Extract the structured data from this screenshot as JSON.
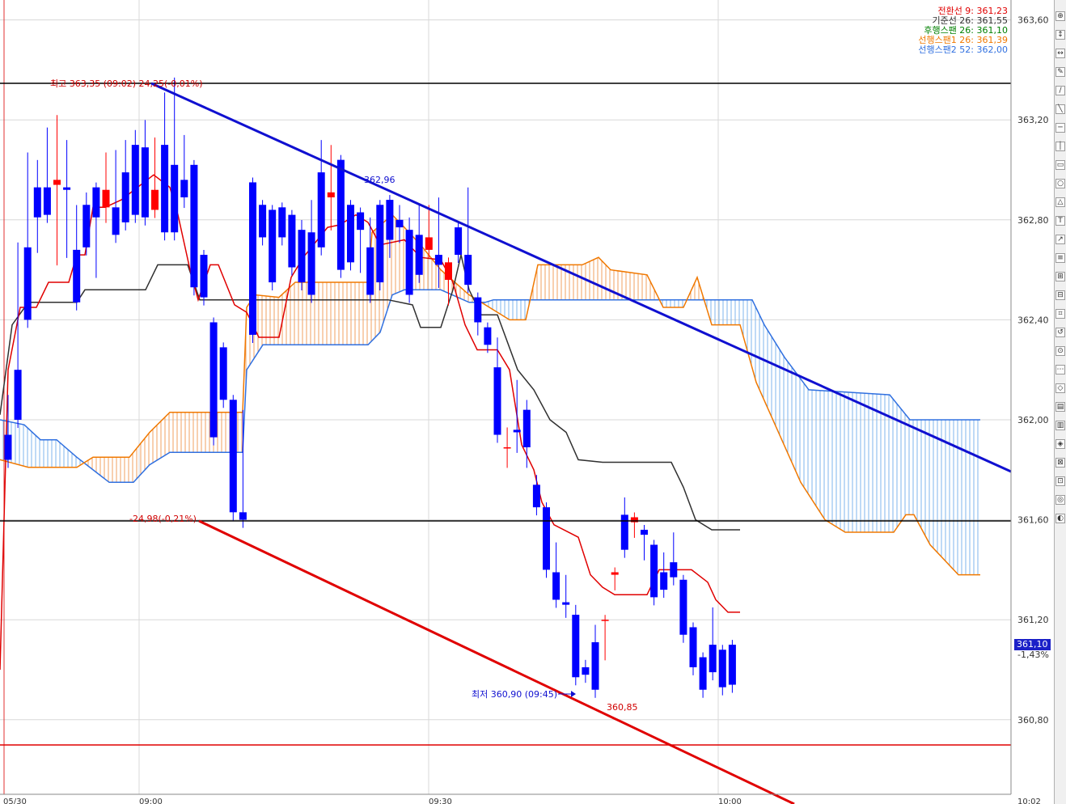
{
  "chart_data": {
    "type": "candlestick",
    "yaxis": {
      "ticks": [
        "360,80",
        "361,20",
        "361,60",
        "362,00",
        "362,40",
        "362,80",
        "363,20",
        "363,60"
      ]
    },
    "xaxis": {
      "ticks": [
        "05/30",
        "09:00",
        "09:30",
        "10:00",
        "10:02"
      ]
    },
    "legend": [
      {
        "text": "전환선 9: 361,23",
        "color": "#e00000"
      },
      {
        "text": "기준선 26: 361,55",
        "color": "#303030"
      },
      {
        "text": "후행스팬 26: 361,10",
        "color": "#008000"
      },
      {
        "text": "선행스팬1 26: 361,39",
        "color": "#f07800"
      },
      {
        "text": "선행스팬2 52: 362,00",
        "color": "#3070e0"
      }
    ],
    "annotations": {
      "high": "최고 363,35 (09:02) 24,25(-0,01%)",
      "low": "최저 360,90 (09:45)",
      "low_pct": "-24,98(-0,21%)",
      "trend_upper": "362,96",
      "trend_lower": "360,85"
    },
    "last_price": "361,10",
    "last_change": "-1,43%",
    "candles": [
      [
        361.94,
        362.08,
        361.85,
        361.84
      ],
      [
        362.2,
        362.69,
        362.19,
        362.0
      ],
      [
        362.69,
        363.05,
        362.69,
        362.4
      ],
      [
        362.93,
        363.02,
        362.7,
        362.81
      ],
      [
        362.93,
        363.15,
        362.84,
        362.82
      ],
      [
        362.94,
        363.2,
        362.65,
        362.96
      ],
      [
        362.93,
        363.1,
        362.68,
        362.92
      ],
      [
        362.68,
        362.84,
        362.68,
        362.47
      ],
      [
        362.86,
        362.89,
        362.86,
        362.69
      ],
      [
        362.93,
        362.93,
        362.6,
        362.81
      ],
      [
        362.85,
        363.05,
        362.82,
        362.92
      ],
      [
        362.85,
        363.06,
        362.92,
        362.74
      ],
      [
        362.99,
        363.1,
        362.96,
        362.79
      ],
      [
        363.1,
        363.14,
        362.91,
        362.82
      ],
      [
        363.09,
        363.18,
        362.96,
        362.81
      ],
      [
        362.84,
        363.11,
        362.84,
        362.92
      ],
      [
        363.1,
        363.29,
        362.91,
        362.75
      ],
      [
        363.02,
        363.35,
        362.91,
        362.75
      ],
      [
        362.96,
        363.12,
        362.88,
        362.89
      ],
      [
        363.02,
        363.02,
        362.66,
        362.53
      ],
      [
        362.66,
        362.66,
        362.49,
        362.49
      ],
      [
        362.39,
        362.39,
        362.35,
        361.93
      ],
      [
        362.29,
        362.2,
        362.29,
        362.08
      ],
      [
        362.08,
        362.08,
        361.91,
        361.63
      ],
      [
        361.63,
        362.02,
        362.28,
        361.6
      ],
      [
        362.95,
        362.95,
        362.47,
        362.34
      ],
      [
        362.86,
        362.86,
        362.86,
        362.73
      ],
      [
        362.84,
        362.84,
        362.6,
        362.55
      ],
      [
        362.85,
        362.82,
        362.85,
        362.73
      ],
      [
        362.82,
        362.64,
        362.88,
        362.61
      ],
      [
        362.76,
        362.78,
        362.76,
        362.55
      ],
      [
        362.75,
        362.86,
        362.66,
        362.5
      ],
      [
        362.99,
        363.1,
        362.73,
        362.69
      ],
      [
        362.89,
        363.08,
        362.79,
        362.91
      ],
      [
        363.04,
        363.04,
        362.61,
        362.6
      ],
      [
        362.86,
        362.86,
        362.86,
        362.63
      ],
      [
        362.83,
        362.83,
        362.62,
        362.76
      ],
      [
        362.69,
        362.79,
        362.58,
        362.5
      ],
      [
        362.86,
        362.83,
        362.73,
        362.55
      ],
      [
        362.88,
        362.78,
        362.68,
        362.72
      ],
      [
        362.8,
        362.84,
        362.74,
        362.77
      ],
      [
        362.76,
        362.79,
        362.53,
        362.5
      ],
      [
        362.74,
        362.84,
        362.6,
        362.58
      ],
      [
        362.68,
        362.84,
        362.7,
        362.73
      ],
      [
        362.66,
        362.87,
        362.56,
        362.62
      ],
      [
        362.56,
        362.61,
        362.49,
        362.63
      ],
      [
        362.77,
        362.72,
        362.67,
        362.66
      ],
      [
        362.66,
        362.91,
        362.57,
        362.54
      ],
      [
        362.49,
        362.48,
        362.37,
        362.39
      ],
      [
        362.37,
        362.32,
        362.36,
        362.3
      ],
      [
        362.21,
        362.31,
        362.21,
        361.94
      ],
      [
        361.89,
        361.95,
        361.84,
        361.89
      ],
      [
        361.96,
        362.14,
        361.9,
        361.95
      ],
      [
        362.04,
        362.06,
        361.84,
        361.89
      ],
      [
        361.74,
        361.76,
        361.67,
        361.65
      ],
      [
        361.65,
        361.65,
        361.49,
        361.4
      ],
      [
        361.39,
        361.49,
        361.48,
        361.28
      ],
      [
        361.27,
        361.36,
        361.24,
        361.26
      ],
      [
        361.22,
        361.24,
        361.2,
        360.97
      ],
      [
        361.01,
        361.02,
        360.99,
        360.98
      ],
      [
        361.11,
        361.16,
        361.06,
        360.92
      ],
      [
        361.2,
        361.2,
        361.07,
        361.2
      ],
      [
        361.38,
        361.38,
        361.35,
        361.39
      ],
      [
        361.62,
        361.67,
        361.62,
        361.48
      ],
      [
        361.59,
        361.59,
        361.56,
        361.61
      ],
      [
        361.56,
        361.56,
        361.47,
        361.54
      ],
      [
        361.5,
        361.48,
        361.49,
        361.29
      ],
      [
        361.39,
        361.45,
        361.37,
        361.32
      ],
      [
        361.43,
        361.53,
        361.38,
        361.37
      ],
      [
        361.36,
        361.36,
        361.32,
        361.14
      ],
      [
        361.17,
        361.17,
        361.1,
        361.01
      ],
      [
        361.05,
        361.05,
        360.99,
        360.92
      ],
      [
        361.1,
        361.23,
        361.09,
        360.99
      ],
      [
        361.08,
        361.08,
        360.95,
        360.93
      ],
      [
        361.1,
        361.1,
        361.1,
        360.94
      ]
    ]
  }
}
